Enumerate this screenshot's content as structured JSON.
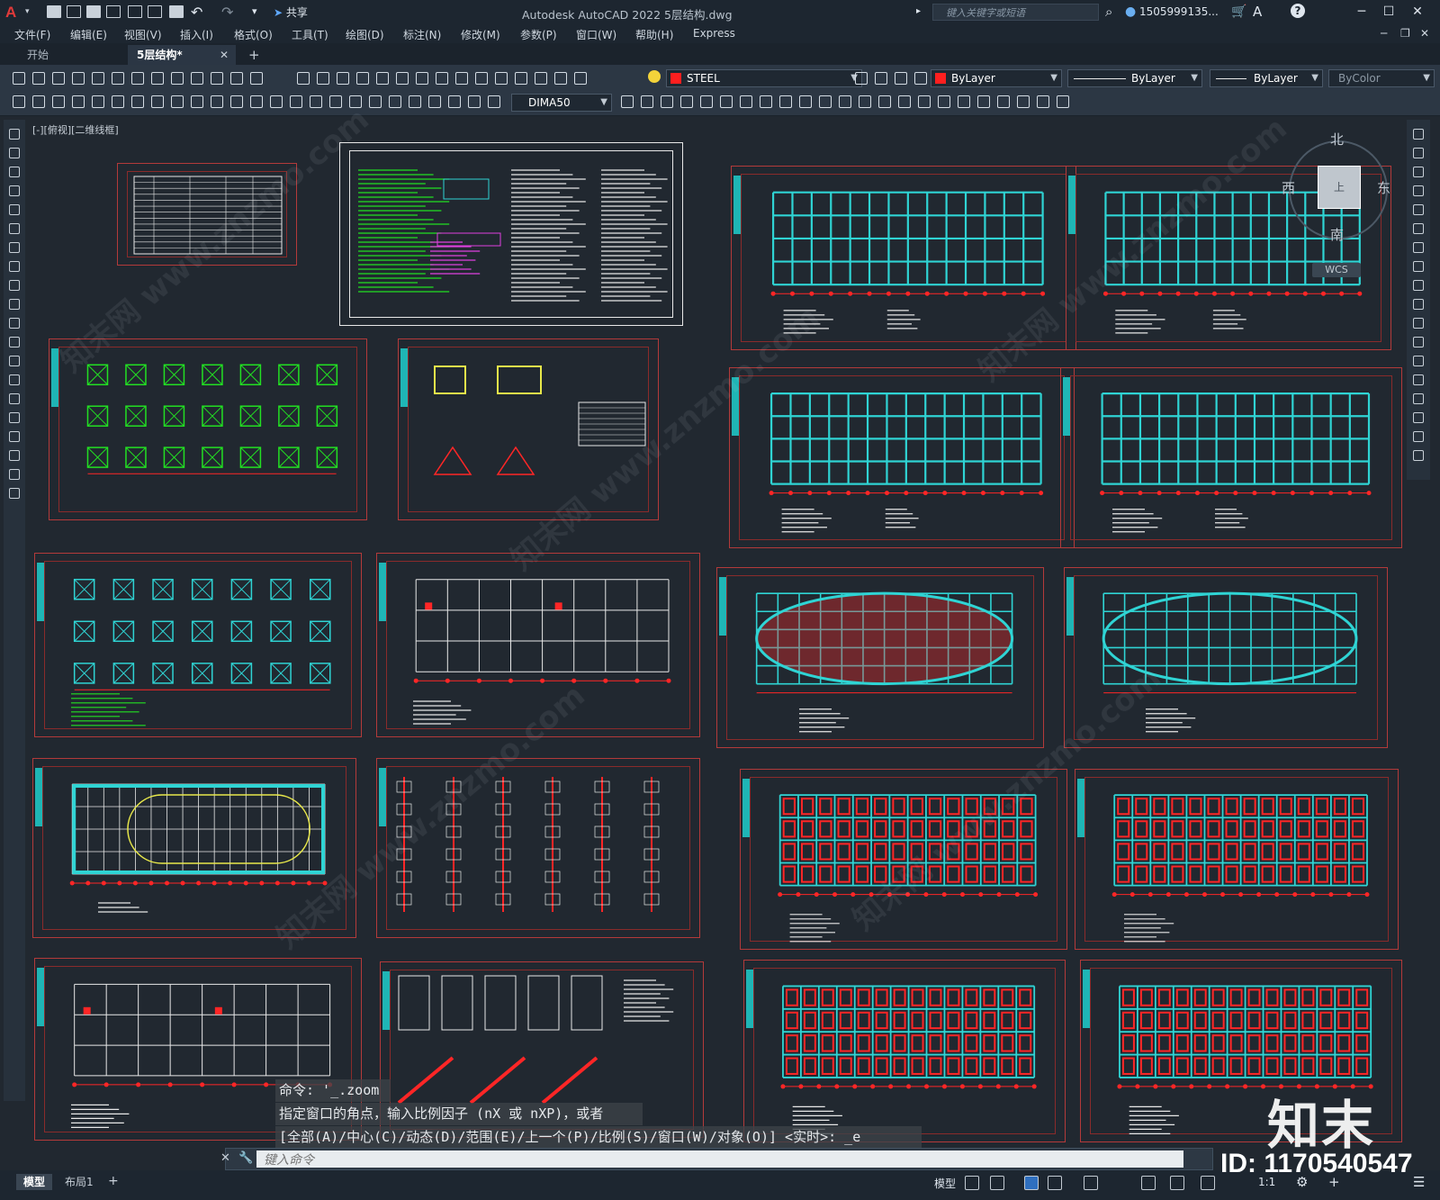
{
  "app": {
    "title": "Autodesk AutoCAD 2022    5层结构.dwg",
    "logo_letter": "A",
    "share_label": "共享",
    "search_placeholder": "键入关键字或短语",
    "user": "1505999135...",
    "window_controls": [
      "─",
      "☐",
      "✕"
    ]
  },
  "menu": [
    "文件(F)",
    "编辑(E)",
    "视图(V)",
    "插入(I)",
    "格式(O)",
    "工具(T)",
    "绘图(D)",
    "标注(N)",
    "修改(M)",
    "参数(P)",
    "窗口(W)",
    "帮助(H)",
    "Express"
  ],
  "tabs": {
    "start": "开始",
    "active": "5层结构*",
    "close": "✕",
    "add": "+"
  },
  "toolbar": {
    "layer": "STEEL",
    "color": "ByLayer",
    "linetype": "ByLayer",
    "lineweight": "ByLayer",
    "plotstyle": "ByColor",
    "dimstyle": "DIMA50"
  },
  "viewport_label": "[-][俯视][二维线框]",
  "viewcube": {
    "north": "北",
    "south": "南",
    "east": "东",
    "west": "西",
    "top": "上",
    "wcs": "WCS"
  },
  "command_history": [
    "命令: '_.zoom",
    "指定窗口的角点，输入比例因子 (nX 或 nXP)，或者",
    "[全部(A)/中心(C)/动态(D)/范围(E)/上一个(P)/比例(S)/窗口(W)/对象(O)] <实时>: _e"
  ],
  "command_placeholder": "键入命令",
  "layout_tabs": [
    "模型",
    "布局1"
  ],
  "status": {
    "model": "模型",
    "scale": "1:1"
  },
  "watermark": {
    "brand": "知末",
    "id": "ID: 1170540547",
    "site": "知末网 www.znzmo.com"
  },
  "colors": {
    "accent_red": "#e03a3a",
    "frame_red": "#b33a3a",
    "cyan": "#2fd4d4",
    "green": "#22e022",
    "canvas": "#212830"
  }
}
